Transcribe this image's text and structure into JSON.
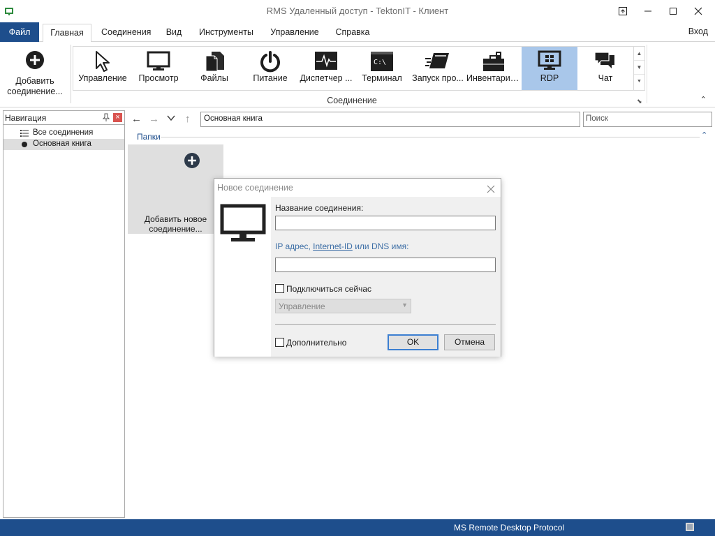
{
  "window": {
    "title": "RMS Удаленный доступ - TektonIT - Клиент"
  },
  "menu": {
    "file": "Файл",
    "tabs": [
      "Главная",
      "Соединения",
      "Вид",
      "Инструменты",
      "Управление",
      "Справка"
    ],
    "login": "Вход"
  },
  "ribbon": {
    "add_connection": "Добавить соединение...",
    "gallery": [
      {
        "label": "Управление",
        "icon": "cursor-icon"
      },
      {
        "label": "Просмотр",
        "icon": "monitor-icon"
      },
      {
        "label": "Файлы",
        "icon": "files-icon"
      },
      {
        "label": "Питание",
        "icon": "power-icon"
      },
      {
        "label": "Диспетчер ...",
        "icon": "task-manager-icon"
      },
      {
        "label": "Терминал",
        "icon": "terminal-icon"
      },
      {
        "label": "Запуск про...",
        "icon": "run-program-icon"
      },
      {
        "label": "Инвентариз...",
        "icon": "inventory-icon"
      },
      {
        "label": "RDP",
        "icon": "rdp-icon"
      },
      {
        "label": "Чат",
        "icon": "chat-icon"
      }
    ],
    "group_label": "Соединение"
  },
  "nav": {
    "title": "Навигация",
    "items": [
      {
        "label": "Все соединения",
        "icon": "list-icon"
      },
      {
        "label": "Основная книга",
        "icon": "bullet-icon"
      }
    ]
  },
  "address": {
    "value": "Основная книга"
  },
  "search": {
    "placeholder": "Поиск"
  },
  "folders": {
    "label": "Папки",
    "add_tile_label": "Добавить новое соединение..."
  },
  "dialog": {
    "title": "Новое соединение",
    "name_label": "Название соединения:",
    "name_value": "",
    "addr_label_prefix": "IP адрес,",
    "addr_label_link": "Internet-ID",
    "addr_label_suffix": "или DNS имя:",
    "addr_value": "",
    "connect_now": "Подключиться сейчас",
    "mode": "Управление",
    "advanced": "Дополнительно",
    "ok": "OK",
    "cancel": "Отмена"
  },
  "status": {
    "text": "MS Remote Desktop Protocol"
  },
  "colors": {
    "accent": "#1e4e8c",
    "selected": "#a9c7ea"
  }
}
